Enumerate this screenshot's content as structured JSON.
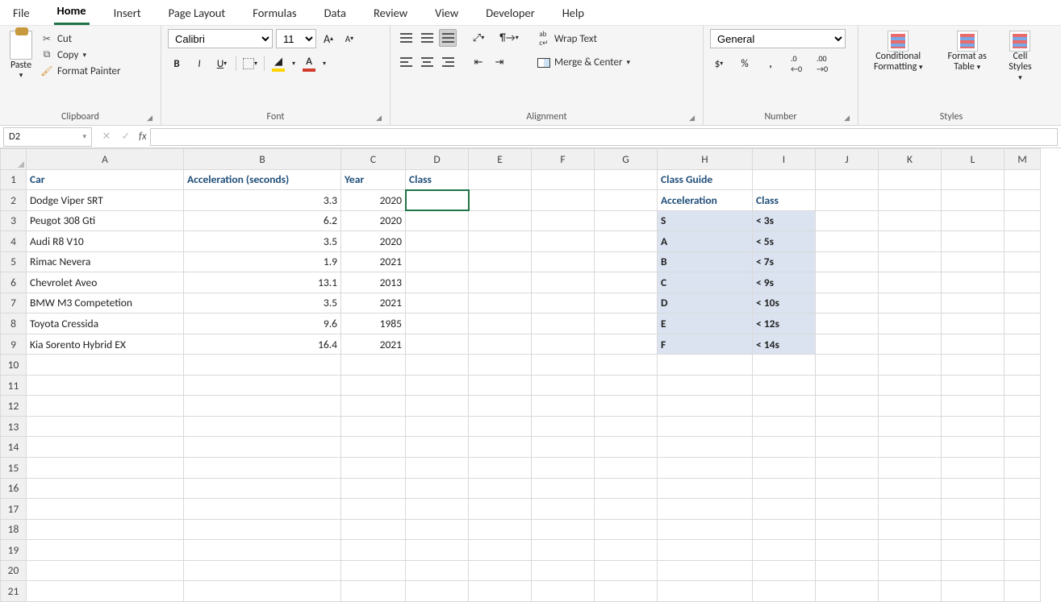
{
  "menu": [
    "File",
    "Home",
    "Insert",
    "Page Layout",
    "Formulas",
    "Data",
    "Review",
    "View",
    "Developer",
    "Help"
  ],
  "menu_active": "Home",
  "clipboard": {
    "paste": "Paste",
    "cut": "Cut",
    "copy": "Copy",
    "fmtpainter": "Format Painter",
    "group": "Clipboard"
  },
  "font": {
    "name": "Calibri",
    "size": "11",
    "group": "Font"
  },
  "alignment": {
    "wrap": "Wrap Text",
    "merge": "Merge & Center",
    "group": "Alignment"
  },
  "number": {
    "format": "General",
    "group": "Number"
  },
  "styles": {
    "cond": "Conditional Formatting",
    "table": "Format as Table",
    "cell": "Cell Styles",
    "group": "Styles"
  },
  "namebox": "D2",
  "formula": "",
  "columns": [
    "A",
    "B",
    "C",
    "D",
    "E",
    "F",
    "G",
    "H",
    "I",
    "J",
    "K",
    "L",
    "M"
  ],
  "headers": {
    "car": "Car",
    "accel": "Acceleration (seconds)",
    "year": "Year",
    "class": "Class"
  },
  "rows": [
    {
      "car": "Dodge Viper SRT",
      "accel": "3.3",
      "year": "2020"
    },
    {
      "car": "Peugot 308 Gti",
      "accel": "6.2",
      "year": "2020"
    },
    {
      "car": "Audi R8 V10",
      "accel": "3.5",
      "year": "2020"
    },
    {
      "car": "Rimac Nevera",
      "accel": "1.9",
      "year": "2021"
    },
    {
      "car": "Chevrolet Aveo",
      "accel": "13.1",
      "year": "2013"
    },
    {
      "car": "BMW M3 Competetion",
      "accel": "3.5",
      "year": "2021"
    },
    {
      "car": "Toyota Cressida",
      "accel": "9.6",
      "year": "1985"
    },
    {
      "car": "Kia Sorento Hybrid EX",
      "accel": "16.4",
      "year": "2021"
    }
  ],
  "guide": {
    "title": "Class Guide",
    "hdr_accel": "Acceleration",
    "hdr_class": "Class",
    "rows": [
      {
        "c": "S",
        "v": "< 3s"
      },
      {
        "c": "A",
        "v": "< 5s"
      },
      {
        "c": "B",
        "v": "< 7s"
      },
      {
        "c": "C",
        "v": "< 9s"
      },
      {
        "c": "D",
        "v": "< 10s"
      },
      {
        "c": "E",
        "v": "< 12s"
      },
      {
        "c": "F",
        "v": "< 14s"
      }
    ]
  },
  "max_rows": 21
}
